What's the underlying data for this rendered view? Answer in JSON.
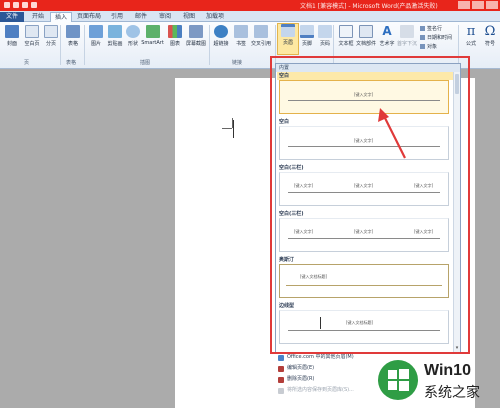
{
  "title_bar": {
    "title": "文档1 [兼容模式] - Microsoft Word(产品激活失败)"
  },
  "tabs": [
    {
      "label": "文件"
    },
    {
      "label": "开始"
    },
    {
      "label": "插入"
    },
    {
      "label": "页面布局"
    },
    {
      "label": "引用"
    },
    {
      "label": "邮件"
    },
    {
      "label": "审阅"
    },
    {
      "label": "视图"
    },
    {
      "label": "加载项"
    }
  ],
  "ribbon": {
    "buttons": {
      "cover": "封面",
      "blank": "空白页",
      "page_break": "分页",
      "table": "表格",
      "picture": "图片",
      "clipart": "剪贴画",
      "shapes": "形状",
      "smartart": "SmartArt",
      "chart": "图表",
      "screenshot": "屏幕截图",
      "hyperlink": "超链接",
      "bookmark": "书签",
      "crossref": "交叉引用",
      "header": "页眉",
      "footer": "页脚",
      "page_number": "页码",
      "textbox": "文本框",
      "quickparts": "文档部件",
      "wordart": "艺术字",
      "dropcap": "首字下沉",
      "equation": "公式",
      "symbol": "符号"
    },
    "small": {
      "signature": "签名行",
      "datetime": "日期和时间",
      "object": "对象"
    },
    "groups": {
      "pages": "页",
      "tables": "表格",
      "illustrations": "插图",
      "links": "链接"
    }
  },
  "gallery": {
    "header": "内置",
    "items": [
      {
        "label": "空白",
        "placeholders": [
          "[键入文字]"
        ]
      },
      {
        "label": "空白",
        "placeholders": [
          "[键入文字]"
        ]
      },
      {
        "label": "空白(三栏)",
        "placeholders": [
          "[键入文字]",
          "[键入文字]",
          "[键入文字]"
        ]
      },
      {
        "label": "空白(三栏)",
        "placeholders": [
          "[键入文字]",
          "[键入文字]",
          "[键入文字]"
        ]
      },
      {
        "label": "奥斯汀",
        "placeholders": [
          "[键入文档标题]"
        ]
      },
      {
        "label": "边线型",
        "placeholders": [
          "[键入文档标题]"
        ]
      }
    ]
  },
  "menu": {
    "more": "Office.com 中的其他页眉(M)",
    "edit": "编辑页眉(E)",
    "remove": "删除页眉(R)",
    "save": "将所选内容保存到页眉库(S)..."
  },
  "watermark": {
    "brand": "Win10",
    "subtitle": "系统之家"
  },
  "colors": {
    "title_bar": "#e8251b",
    "highlight": "#e03a3a",
    "selection": "#fde9a9"
  }
}
